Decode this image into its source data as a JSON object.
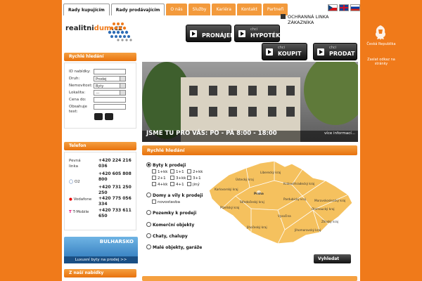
{
  "top_tabs": [
    {
      "label": "Rady kupujícím",
      "main": true
    },
    {
      "label": "Rady prodávajícím",
      "main": true
    },
    {
      "label": "O nás",
      "main": false
    },
    {
      "label": "Služby",
      "main": false
    },
    {
      "label": "Kariéra",
      "main": false
    },
    {
      "label": "Kontakt",
      "main": false
    },
    {
      "label": "Partneři",
      "main": false
    }
  ],
  "logo": {
    "part1": "realitni",
    "part2": "dum",
    "part3": ".cz"
  },
  "hotline": {
    "line1": "OCHRANNÁ LINKA",
    "line2": "ZÁKAZNÍKA"
  },
  "buttons": [
    {
      "small": "",
      "large": "PRONÁJEM"
    },
    {
      "small": "chci",
      "large": "HYPOTÉKU"
    },
    {
      "small": "chci",
      "large": "KOUPIT"
    },
    {
      "small": "chci",
      "large": "PRODAT"
    }
  ],
  "sidebar": {
    "quick_search_title": "Rychlé hledání",
    "fields": [
      {
        "label": "ID nabídky:",
        "value": "",
        "dropdown": false
      },
      {
        "label": "Druh:",
        "value": "Prodej",
        "dropdown": true
      },
      {
        "label": "Nemovitost:",
        "value": "Byty",
        "dropdown": true
      },
      {
        "label": "Lokalita:",
        "value": "---",
        "dropdown": true
      },
      {
        "label": "Cena do:",
        "value": "",
        "dropdown": false
      },
      {
        "label": "Obsahuje",
        "value": "",
        "dropdown": false
      }
    ],
    "contains_label2": "text:",
    "phone_title": "Telefon",
    "phones": [
      {
        "label": "Pevná",
        "label2": "linka",
        "number": "+420 224 216 036"
      },
      {
        "label": "",
        "label2": "",
        "number": "+420 605 808 800"
      },
      {
        "label": "O2",
        "label2": "",
        "number": "+420 731 250 250"
      },
      {
        "label": "Vodafone",
        "label2": "",
        "number": "+420 775 056 334"
      },
      {
        "label": "T-Mobile",
        "label2": "",
        "number": "+420 733 611 650"
      }
    ],
    "banner": {
      "title": "BULHARSKO",
      "subtitle": "Luxusní byty na prodej >>"
    },
    "offers_title": "Z naší nabídky"
  },
  "hero": {
    "caption": "JSME TU PRO VÁS: PO - PÁ 8:00 - 18:00",
    "more": "více informací..."
  },
  "quick_search": {
    "title": "Rychlé hledání",
    "types": [
      {
        "label": "Byty k prodeji",
        "selected": true
      },
      {
        "label": "Domy a vily k prodeji",
        "selected": false
      },
      {
        "label": "Pozemky k prodeji",
        "selected": false
      },
      {
        "label": "Komerční objekty",
        "selected": false
      },
      {
        "label": "Chaty, chalupy",
        "selected": false
      },
      {
        "label": "Malé objekty, garáže",
        "selected": false
      }
    ],
    "flat_sizes": [
      "1+kk",
      "1+1",
      "2+kk",
      "2+1",
      "3+kk",
      "3+1",
      "4+kk",
      "4+1",
      "jiný"
    ],
    "house_sub": "novostavba",
    "regions": [
      "Liberecký kraj",
      "Ústecký kraj",
      "Královéhradecký kraj",
      "Karlovarský kraj",
      "Praha",
      "Středočeský kraj",
      "Pardubický kraj",
      "Moravskoslezský kraj",
      "Plzeňský kraj",
      "Vysočina",
      "Olomoucký kraj",
      "Jihočeský kraj",
      "Jihomoravský kraj",
      "Zlínský kraj"
    ],
    "submit": "Vyhledat"
  },
  "right": {
    "crest_label": "Česká Republika",
    "link": "Zaslat odkaz na stránky"
  },
  "colors": {
    "orange": "#f07a1a",
    "map": "#f5c15e"
  }
}
